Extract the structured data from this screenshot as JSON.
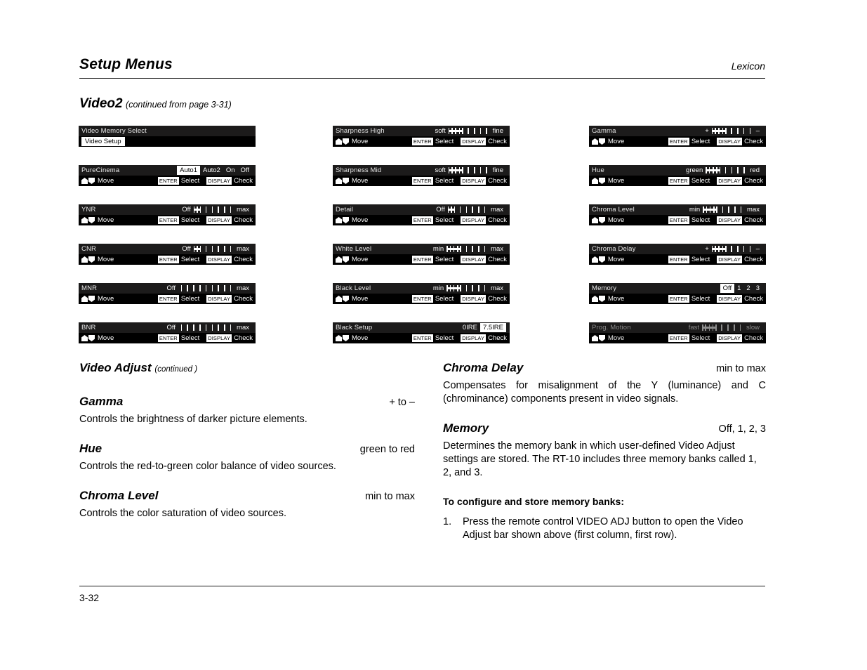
{
  "header": {
    "title": "Setup Menus",
    "brand": "Lexicon"
  },
  "section": {
    "name": "Video2",
    "note": "(continued from page 3-31)"
  },
  "footer": {
    "page_number": "3-32"
  },
  "osd_common": {
    "move_label": "Move",
    "enter_key": "ENTER",
    "select_label": "Select",
    "display_key": "DISPLAY",
    "check_label": "Check"
  },
  "osd_columns": [
    {
      "column": 1,
      "items": [
        {
          "label": "Video Memory Select",
          "kind": "submenu",
          "submenu_label": "Video Setup",
          "dim": false
        },
        {
          "label": "PureCinema",
          "kind": "options",
          "options": [
            "Auto1",
            "Auto2",
            "On",
            "Off"
          ],
          "selected": "Auto1",
          "dim": false
        },
        {
          "label": "YNR",
          "kind": "slider",
          "min_label": "Off",
          "max_label": "max",
          "bar_segments": 2,
          "ticks": 5,
          "dim": false
        },
        {
          "label": "CNR",
          "kind": "slider",
          "min_label": "Off",
          "max_label": "max",
          "bar_segments": 2,
          "ticks": 5,
          "dim": false
        },
        {
          "label": "MNR",
          "kind": "slider",
          "min_label": "Off",
          "max_label": "max",
          "bar_segments": 0,
          "ticks": 9,
          "dim": false
        },
        {
          "label": "BNR",
          "kind": "slider",
          "min_label": "Off",
          "max_label": "max",
          "bar_segments": 0,
          "ticks": 9,
          "dim": false
        }
      ]
    },
    {
      "column": 2,
      "items": [
        {
          "label": "Sharpness High",
          "kind": "slider",
          "min_label": "soft",
          "max_label": "fine",
          "bar_segments": 4,
          "ticks": 4,
          "dim": false
        },
        {
          "label": "Sharpness Mid",
          "kind": "slider",
          "min_label": "soft",
          "max_label": "fine",
          "bar_segments": 4,
          "ticks": 4,
          "dim": false
        },
        {
          "label": "Detail",
          "kind": "slider",
          "min_label": "Off",
          "max_label": "max",
          "bar_segments": 2,
          "ticks": 5,
          "dim": false
        },
        {
          "label": "White Level",
          "kind": "slider",
          "min_label": "min",
          "max_label": "max",
          "bar_segments": 4,
          "ticks": 4,
          "dim": false
        },
        {
          "label": "Black Level",
          "kind": "slider",
          "min_label": "min",
          "max_label": "max",
          "bar_segments": 4,
          "ticks": 4,
          "dim": false
        },
        {
          "label": "Black Setup",
          "kind": "options",
          "options": [
            "0IRE",
            "7.5IRE"
          ],
          "selected": "7.5IRE",
          "dim": false
        }
      ]
    },
    {
      "column": 3,
      "items": [
        {
          "label": "Gamma",
          "kind": "slider",
          "min_label": "+",
          "max_label": "–",
          "bar_segments": 4,
          "ticks": 4,
          "dim": false
        },
        {
          "label": "Hue",
          "kind": "slider",
          "min_label": "green",
          "max_label": "red",
          "bar_segments": 4,
          "ticks": 4,
          "dim": false
        },
        {
          "label": "Chroma Level",
          "kind": "slider",
          "min_label": "min",
          "max_label": "max",
          "bar_segments": 4,
          "ticks": 4,
          "dim": false
        },
        {
          "label": "Chroma Delay",
          "kind": "slider",
          "min_label": "+",
          "max_label": "–",
          "bar_segments": 4,
          "ticks": 4,
          "dim": false
        },
        {
          "label": "Memory",
          "kind": "options",
          "options": [
            "Off",
            "1",
            "2",
            "3"
          ],
          "selected": "Off",
          "dim": false
        },
        {
          "label": "Prog. Motion",
          "kind": "slider",
          "min_label": "fast",
          "max_label": "slow",
          "bar_segments": 4,
          "ticks": 4,
          "dim": true
        }
      ]
    }
  ],
  "body": {
    "left": {
      "group_heading": "Video Adjust",
      "group_note": "(continued )",
      "entries": [
        {
          "title": "Gamma",
          "range": "+ to –",
          "desc": "Controls the brightness of darker picture elements."
        },
        {
          "title": "Hue",
          "range": "green to red",
          "desc": "Controls the red-to-green color balance of video sources."
        },
        {
          "title": "Chroma Level",
          "range": "min to max",
          "desc": "Controls the color saturation of video sources."
        }
      ]
    },
    "right": {
      "entries": [
        {
          "title": "Chroma Delay",
          "range": "min to max",
          "desc": "Compensates for misalignment of the Y (luminance) and C (chrominance) components present in video signals."
        },
        {
          "title": "Memory",
          "range": "Off, 1, 2, 3",
          "desc": "Determines the memory bank in which user-defined Video Adjust settings are stored. The RT-10 includes three memory banks called 1, 2, and 3."
        }
      ],
      "procedure": {
        "heading": "To configure and store memory banks:",
        "steps": [
          {
            "num": "1.",
            "text": "Press the remote control VIDEO ADJ button to open the Video Adjust bar shown above (first column, first row)."
          }
        ]
      }
    }
  }
}
